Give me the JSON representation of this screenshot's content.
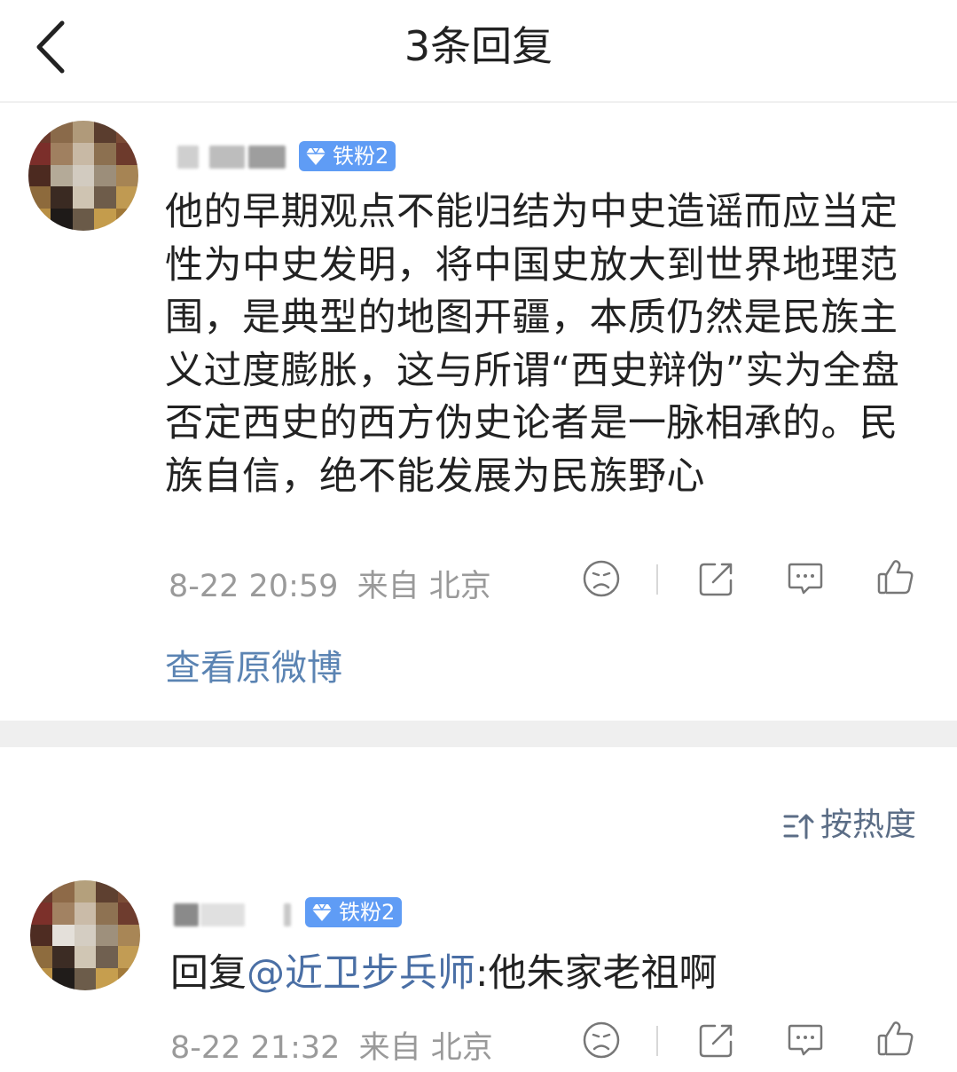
{
  "header": {
    "title": "3条回复",
    "back_icon": "chevron-left-icon"
  },
  "comment": {
    "username": "",
    "badge": "铁粉2",
    "text": "他的早期观点不能归结为中史造谣而应当定性为中史发明，将中国史放大到世界地理范围，是典型的地图开疆，本质仍然是民族主义过度膨胀，这与所谓“西史辩伪”实为全盘否定西史的西方伪史论者是一脉相承的。民族自信，绝不能发展为民族野心",
    "time": "8-22 20:59",
    "location": "来自 北京",
    "view_original": "查看原微博"
  },
  "sort": {
    "label": "按热度",
    "icon": "sort-icon"
  },
  "reply": {
    "username": "",
    "badge": "铁粉2",
    "prefix": "回复",
    "mention": "@近卫步兵师",
    "text": ":他朱家老祖啊",
    "time": "8-22 21:32",
    "location": "来自 北京"
  },
  "colors": {
    "badge": "#5f9cf5",
    "link": "#5b84b3",
    "meta": "#9a9a9a",
    "divider": "#efefef"
  }
}
